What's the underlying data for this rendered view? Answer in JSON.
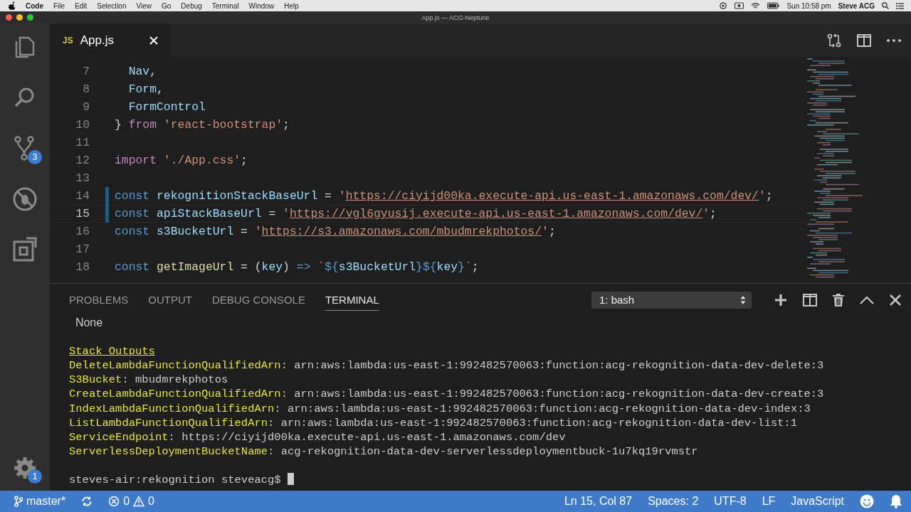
{
  "menu_bar": {
    "app_name": "Code",
    "items": [
      "File",
      "Edit",
      "Selection",
      "View",
      "Go",
      "Debug",
      "Terminal",
      "Window",
      "Help"
    ],
    "clock": "Sun 10:58 pm",
    "user": "Steve ACG"
  },
  "window": {
    "title": "App.js — ACG-Neptune"
  },
  "activity_bar": {
    "items": [
      {
        "kind": "files"
      },
      {
        "kind": "search"
      },
      {
        "kind": "source-control",
        "badge": "3"
      },
      {
        "kind": "debug"
      },
      {
        "kind": "extensions"
      }
    ],
    "settings_badge": "1"
  },
  "editor_tabs": [
    {
      "file_type": "JS",
      "label": "App.js",
      "selected": true
    }
  ],
  "editor": {
    "lines": [
      {
        "number": "7",
        "current": false,
        "modified": false,
        "tokens": [
          {
            "kind": "variable",
            "text": "  Nav"
          },
          {
            "kind": "plain",
            "text": ","
          }
        ]
      },
      {
        "number": "8",
        "current": false,
        "modified": false,
        "tokens": [
          {
            "kind": "variable",
            "text": "  Form"
          },
          {
            "kind": "plain",
            "text": ","
          }
        ]
      },
      {
        "number": "9",
        "current": false,
        "modified": false,
        "tokens": [
          {
            "kind": "variable",
            "text": "  FormControl"
          }
        ]
      },
      {
        "number": "10",
        "current": false,
        "modified": false,
        "tokens": [
          {
            "kind": "plain",
            "text": "} "
          },
          {
            "kind": "control",
            "text": "from"
          },
          {
            "kind": "string",
            "text": " 'react-bootstrap'"
          },
          {
            "kind": "plain",
            "text": ";"
          }
        ]
      },
      {
        "number": "11",
        "current": false,
        "modified": false
      },
      {
        "number": "12",
        "current": false,
        "modified": false,
        "tokens": [
          {
            "kind": "control",
            "text": "import"
          },
          {
            "kind": "string",
            "text": " './App.css'"
          },
          {
            "kind": "plain",
            "text": ";"
          }
        ]
      },
      {
        "number": "13",
        "current": false,
        "modified": false
      },
      {
        "number": "14",
        "current": false,
        "modified": true,
        "tokens": [
          {
            "kind": "keyword",
            "text": "const"
          },
          {
            "kind": "variable",
            "text": " rekognitionStackBaseUrl"
          },
          {
            "kind": "plain",
            "text": " = "
          },
          {
            "kind": "string",
            "text": "'"
          },
          {
            "kind": "url",
            "text": "https://ciyijd00ka.execute-api.us-east-1.amazonaws.com/dev/"
          },
          {
            "kind": "string",
            "text": "'"
          },
          {
            "kind": "plain",
            "text": ";"
          }
        ]
      },
      {
        "number": "15",
        "current": true,
        "modified": true,
        "tokens": [
          {
            "kind": "keyword",
            "text": "const"
          },
          {
            "kind": "variable",
            "text": " apiStackBaseUrl"
          },
          {
            "kind": "plain",
            "text": " = "
          },
          {
            "kind": "string",
            "text": "'"
          },
          {
            "kind": "url",
            "text": "https://ygl6gyusij.execute-api.us-east-1.amazonaws.com/dev/"
          },
          {
            "kind": "string",
            "text": "'"
          },
          {
            "kind": "plain",
            "text": ";"
          }
        ]
      },
      {
        "number": "16",
        "current": false,
        "modified": false,
        "tokens": [
          {
            "kind": "keyword",
            "text": "const"
          },
          {
            "kind": "variable",
            "text": " s3BucketUrl"
          },
          {
            "kind": "plain",
            "text": " = "
          },
          {
            "kind": "string",
            "text": "'"
          },
          {
            "kind": "url",
            "text": "https://s3.amazonaws.com/mbudmrekphotos/"
          },
          {
            "kind": "string",
            "text": "'"
          },
          {
            "kind": "plain",
            "text": ";"
          }
        ]
      },
      {
        "number": "17",
        "current": false,
        "modified": false
      },
      {
        "number": "18",
        "current": false,
        "modified": false,
        "tokens": [
          {
            "kind": "keyword",
            "text": "const"
          },
          {
            "kind": "function",
            "text": " getImageUrl"
          },
          {
            "kind": "plain",
            "text": " = ("
          },
          {
            "kind": "variable",
            "text": "key"
          },
          {
            "kind": "plain",
            "text": ") "
          },
          {
            "kind": "keyword",
            "text": "=>"
          },
          {
            "kind": "string",
            "text": " `"
          },
          {
            "kind": "keyword",
            "text": "${"
          },
          {
            "kind": "variable",
            "text": "s3BucketUrl"
          },
          {
            "kind": "keyword",
            "text": "}${"
          },
          {
            "kind": "variable",
            "text": "key"
          },
          {
            "kind": "keyword",
            "text": "}"
          },
          {
            "kind": "string",
            "text": "`"
          },
          {
            "kind": "plain",
            "text": ";"
          }
        ]
      }
    ]
  },
  "panel": {
    "tabs": [
      {
        "label": "PROBLEMS",
        "selected": false
      },
      {
        "label": "OUTPUT",
        "selected": false
      },
      {
        "label": "DEBUG CONSOLE",
        "selected": false
      },
      {
        "label": "TERMINAL",
        "selected": true
      }
    ],
    "terminal_selector": "1: bash",
    "lines": [
      {
        "kind": "output",
        "segments": [
          {
            "kind": "plain",
            "text": "  None"
          }
        ]
      },
      {
        "kind": "blank"
      },
      {
        "kind": "output",
        "segments": [
          {
            "kind": "heading",
            "text": "Stack Outputs"
          }
        ]
      },
      {
        "kind": "output",
        "segments": [
          {
            "kind": "key",
            "text": "DeleteLambdaFunctionQualifiedArn"
          },
          {
            "kind": "value",
            "text": ": arn:aws:lambda:us-east-1:992482570063:function:acg-rekognition-data-dev-delete:3"
          }
        ]
      },
      {
        "kind": "output",
        "segments": [
          {
            "kind": "key",
            "text": "S3Bucket"
          },
          {
            "kind": "value",
            "text": ": mbudmrekphotos"
          }
        ]
      },
      {
        "kind": "output",
        "segments": [
          {
            "kind": "key",
            "text": "CreateLambdaFunctionQualifiedArn"
          },
          {
            "kind": "value",
            "text": ": arn:aws:lambda:us-east-1:992482570063:function:acg-rekognition-data-dev-create:3"
          }
        ]
      },
      {
        "kind": "output",
        "segments": [
          {
            "kind": "key",
            "text": "IndexLambdaFunctionQualifiedArn"
          },
          {
            "kind": "value",
            "text": ": arn:aws:lambda:us-east-1:992482570063:function:acg-rekognition-data-dev-index:3"
          }
        ]
      },
      {
        "kind": "output",
        "segments": [
          {
            "kind": "key",
            "text": "ListLambdaFunctionQualifiedArn"
          },
          {
            "kind": "value",
            "text": ": arn:aws:lambda:us-east-1:992482570063:function:acg-rekognition-data-dev-list:1"
          }
        ]
      },
      {
        "kind": "output",
        "segments": [
          {
            "kind": "key",
            "text": "ServiceEndpoint"
          },
          {
            "kind": "value",
            "text": ": https://ciyijd00ka.execute-api.us-east-1.amazonaws.com/dev"
          }
        ]
      },
      {
        "kind": "output",
        "segments": [
          {
            "kind": "key",
            "text": "ServerlessDeploymentBucketName"
          },
          {
            "kind": "value",
            "text": ": acg-rekognition-data-dev-serverlessdeploymentbuck-1u7kq19rvmstr"
          }
        ]
      },
      {
        "kind": "blank"
      },
      {
        "kind": "prompt",
        "text": "steves-air:rekognition steveacg$"
      }
    ]
  },
  "status_bar": {
    "branch": "master*",
    "errors": "0",
    "warnings": "0",
    "items": [
      "Ln 15, Col 87",
      "Spaces: 2",
      "UTF-8",
      "LF",
      "JavaScript"
    ]
  }
}
